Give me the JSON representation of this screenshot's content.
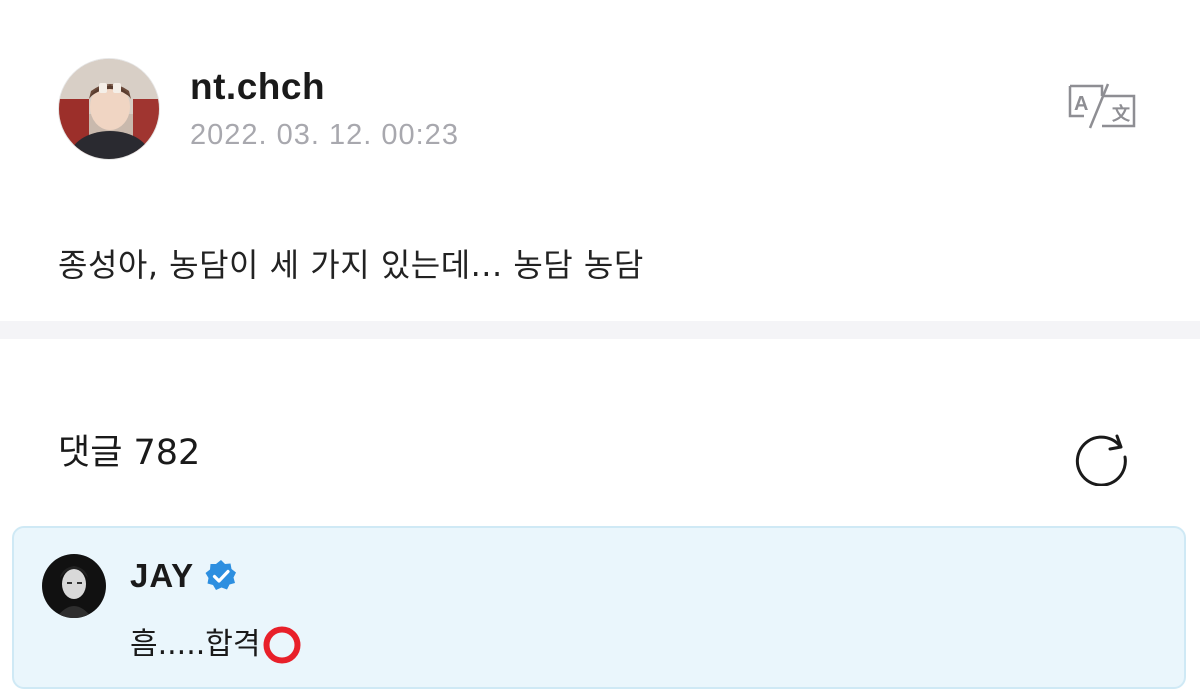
{
  "post": {
    "author": "nt.chch",
    "date": "2022. 03. 12. 00:23",
    "body": "종성아, 농담이 세 가지 있는데... 농담 농담",
    "translate_icon": "translate-icon"
  },
  "comments": {
    "label": "댓글",
    "count": "782",
    "header": "댓글 782",
    "refresh_icon": "refresh-icon"
  },
  "highlighted_comment": {
    "author": "JAY",
    "verified": true,
    "verified_icon": "verified-badge-icon",
    "text": "흠.....합격",
    "emoji_icon": "heavy-large-circle-icon"
  },
  "colors": {
    "accent_blue": "#2d8fe0",
    "comment_bg": "#eaf6fc",
    "comment_border": "#cfe9f5",
    "date_gray": "#a8a8ae",
    "emoji_red": "#e8202a"
  }
}
